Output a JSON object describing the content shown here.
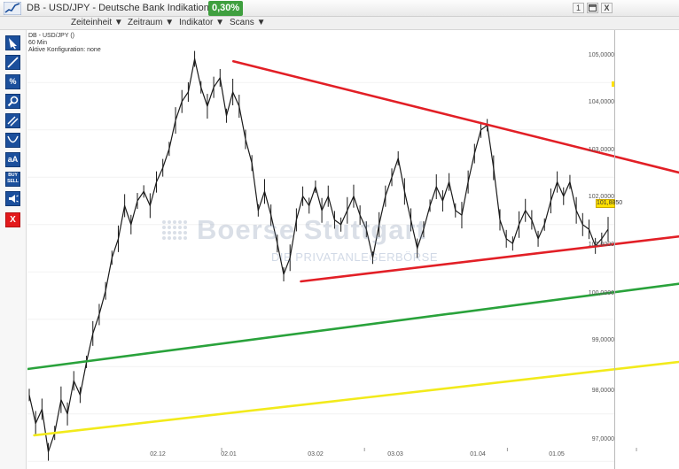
{
  "window": {
    "title": "DB - USD/JPY - Deutsche Bank Indikation",
    "change": "0,30%",
    "win_number": "1",
    "close_label": "X"
  },
  "menu": [
    {
      "label": "Zeiteinheit ▼"
    },
    {
      "label": "Zeitraum ▼"
    },
    {
      "label": "Indikator ▼"
    },
    {
      "label": "Scans ▼"
    }
  ],
  "toolbar": {
    "percent_label": "%",
    "text_label": "aA",
    "buy_label": "BUY",
    "sell_label": "SELL",
    "delete_label": "X",
    "icons": [
      "cursor-arrow-icon",
      "line-tool-icon",
      "percent-icon",
      "zoom-icon",
      "parallel-lines-icon",
      "curve-tool-icon",
      "text-tool-icon",
      "buy-sell-icon",
      "alert-icon",
      "delete-icon"
    ]
  },
  "chart_label": {
    "line1": "DB - USD/JPY ()",
    "line2": "60 Min",
    "line3": "Aktive Konfiguration: none"
  },
  "watermark": {
    "name": "Boerse Stuttgart",
    "slogan": "DIE PRIVATANLEGERBÖRSE"
  },
  "price_tag": "101,8850",
  "colors": {
    "price_line": "#1a1a1a",
    "resistance": "#e21f26",
    "support_red": "#e21f26",
    "support_green": "#29a23b",
    "support_yellow": "#f2ea1b"
  },
  "chart_data": {
    "type": "line",
    "ylim": [
      96.6,
      105.6
    ],
    "y_ticks": [
      "105,0000",
      "104,0000",
      "103,0000",
      "102,0000",
      "101,0000",
      "100,0000",
      "99,0000",
      "98,0000",
      "97,0000"
    ],
    "y_tick_values": [
      105,
      104,
      103,
      102,
      101,
      100,
      99,
      98,
      97
    ],
    "x_ticks": [
      "02.12",
      "02.01",
      "03.02",
      "03.03",
      "01.04",
      "01.05"
    ],
    "x_tick_positions": [
      5.0,
      36.0,
      67.0,
      95.0,
      125.0,
      155.0
    ],
    "x_range": [
      -24.0,
      169.0
    ],
    "series": [
      {
        "style": "price",
        "x": [
          -24,
          -22,
          -20,
          -18,
          -16,
          -14,
          -12,
          -10,
          -8,
          -6,
          -4,
          -2,
          0,
          2,
          4,
          6,
          8,
          10,
          12,
          14,
          16,
          18,
          20,
          22,
          24,
          26,
          28,
          30,
          32,
          34,
          36,
          38,
          40,
          42,
          44,
          46,
          48,
          50,
          52,
          54,
          56,
          58,
          60,
          62,
          64,
          66,
          68,
          70,
          72,
          74,
          76,
          78,
          80,
          82,
          84,
          86,
          88,
          90,
          92,
          94,
          96,
          98,
          100,
          102,
          104,
          106,
          108,
          110,
          112,
          114,
          116,
          118,
          120,
          122,
          124,
          126,
          128,
          130,
          132,
          134,
          136,
          138,
          140,
          142,
          144,
          146,
          148,
          150,
          152,
          154,
          156,
          158
        ],
        "values": [
          98.4,
          97.8,
          98.1,
          97.2,
          97.6,
          98.3,
          98.0,
          98.7,
          98.4,
          99.1,
          99.7,
          100.1,
          100.6,
          101.3,
          101.7,
          102.4,
          102.0,
          102.5,
          102.7,
          102.4,
          102.9,
          103.2,
          103.6,
          104.2,
          104.6,
          104.8,
          105.5,
          104.9,
          104.5,
          104.9,
          105.1,
          104.3,
          104.8,
          104.5,
          103.8,
          103.3,
          102.3,
          102.7,
          102.2,
          101.6,
          100.95,
          101.3,
          102.1,
          102.6,
          102.4,
          102.8,
          102.3,
          102.6,
          102.1,
          102.0,
          102.3,
          102.6,
          102.2,
          101.9,
          101.3,
          102.0,
          102.6,
          103.0,
          103.4,
          102.7,
          102.1,
          101.5,
          101.9,
          102.4,
          102.8,
          102.5,
          102.9,
          102.3,
          102.2,
          102.9,
          103.5,
          104.0,
          104.1,
          103.2,
          102.1,
          101.7,
          101.6,
          102.0,
          102.3,
          102.1,
          101.7,
          102.0,
          102.5,
          102.9,
          102.6,
          102.9,
          102.3,
          102.0,
          101.9,
          101.55,
          101.7,
          101.9
        ]
      },
      {
        "style": "trend",
        "color": "resistance",
        "x": [
          37,
          169
        ],
        "values": [
          105.45,
          103.1
        ]
      },
      {
        "style": "trend",
        "color": "support_red",
        "x": [
          57,
          169
        ],
        "values": [
          100.8,
          101.75
        ]
      },
      {
        "style": "trend",
        "color": "support_green",
        "x": [
          -24,
          169
        ],
        "values": [
          98.95,
          100.75
        ]
      },
      {
        "style": "trend",
        "color": "support_yellow",
        "x": [
          -22,
          169
        ],
        "values": [
          97.55,
          99.1
        ]
      }
    ]
  }
}
